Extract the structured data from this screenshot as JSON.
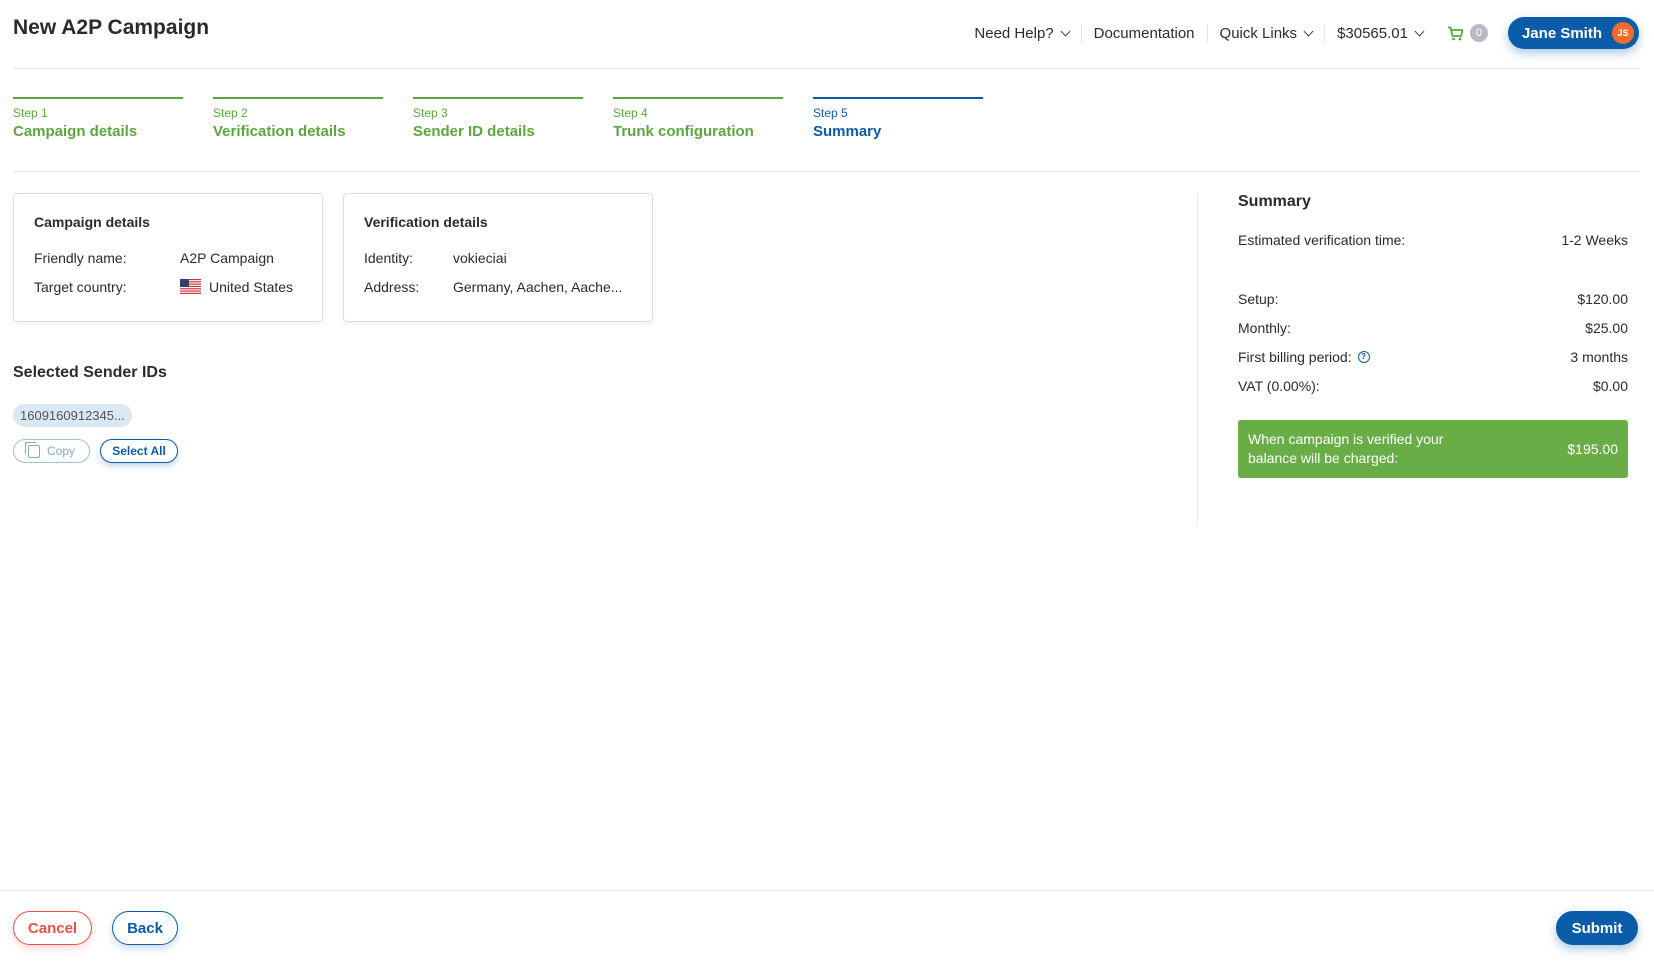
{
  "page_title": "New A2P Campaign",
  "topnav": {
    "need_help": "Need Help?",
    "documentation": "Documentation",
    "quick_links": "Quick Links",
    "balance": "$30565.01",
    "cart_count": "0",
    "user_name": "Jane Smith",
    "user_initials": "JS"
  },
  "steps": [
    {
      "num": "Step 1",
      "name": "Campaign details",
      "state": "complete"
    },
    {
      "num": "Step 2",
      "name": "Verification details",
      "state": "complete"
    },
    {
      "num": "Step 3",
      "name": "Sender ID details",
      "state": "complete"
    },
    {
      "num": "Step 4",
      "name": "Trunk configuration",
      "state": "complete"
    },
    {
      "num": "Step 5",
      "name": "Summary",
      "state": "active"
    }
  ],
  "campaign_card": {
    "title": "Campaign details",
    "friendly_name_label": "Friendly name:",
    "friendly_name_value": "A2P Campaign",
    "target_country_label": "Target country:",
    "target_country_value": "United States"
  },
  "verification_card": {
    "title": "Verification details",
    "identity_label": "Identity:",
    "identity_value": "vokieciai",
    "address_label": "Address:",
    "address_value": "Germany, Aachen, Aache..."
  },
  "sender_ids": {
    "title": "Selected Sender IDs",
    "items": [
      "1609160912345..."
    ],
    "copy_label": "Copy",
    "select_all_label": "Select All"
  },
  "summary": {
    "title": "Summary",
    "est_label": "Estimated verification time:",
    "est_value": "1-2 Weeks",
    "setup_label": "Setup:",
    "setup_value": "$120.00",
    "monthly_label": "Monthly:",
    "monthly_value": "$25.00",
    "billing_label": "First billing period:",
    "billing_value": "3 months",
    "vat_label": "VAT (0.00%):",
    "vat_value": "$0.00",
    "charge_message": "When campaign is verified your balance will be charged:",
    "charge_value": "$195.00"
  },
  "footer": {
    "cancel_label": "Cancel",
    "back_label": "Back",
    "submit_label": "Submit"
  },
  "colors": {
    "primary": "#0a5ca8",
    "success": "#5aa83d",
    "charge_bg": "#69ad47",
    "danger": "#e9504a",
    "avatar": "#f26a2e"
  }
}
